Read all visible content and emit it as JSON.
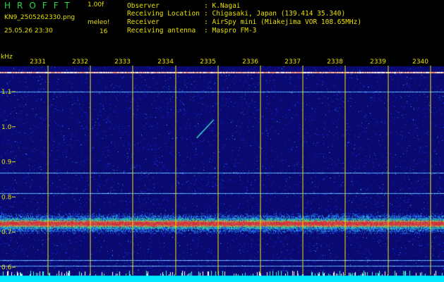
{
  "header": {
    "brand": "HROFFT",
    "version": "1.00f",
    "filename": "KN9_2505262330.png",
    "meteor_label": "meleo!",
    "timestamp": "25.05.26 23:30",
    "meteor_count": "16",
    "meta": [
      {
        "key": "Observer",
        "sep": ":",
        "value": "K.Nagai"
      },
      {
        "key": "Receiving Location",
        "sep": ":",
        "value": "Chigasaki, Japan (139.414 35.340)"
      },
      {
        "key": "Receiver",
        "sep": ":",
        "value": "AirSpy mini (Miakejima VOR 108.65MHz)"
      },
      {
        "key": "Receiving antenna",
        "sep": ":",
        "value": "Maspro FM-3"
      }
    ]
  },
  "colors": {
    "background": "#000000",
    "text": "#e8e000",
    "brand": "#2bd64a",
    "grid_vertical": "#e8e000",
    "carrier_band": "#ff3a3a",
    "bottom_band": "#00ffff",
    "noise_floor": "#0a0a7a"
  },
  "chart_data": {
    "type": "heatmap",
    "ylabel": "kHz",
    "y_ticks": [
      "1.1",
      "1.0",
      "0.9",
      "0.8",
      "0.7",
      "0.6"
    ],
    "y_tick_values": [
      1.1,
      1.0,
      0.9,
      0.8,
      0.7,
      0.6
    ],
    "x_ticks": [
      "2331",
      "2332",
      "2333",
      "2334",
      "2335",
      "2336",
      "2337",
      "2338",
      "2339",
      "2340"
    ],
    "ylim": [
      0.58,
      1.17
    ],
    "horizontal_lines_khz": [
      1.156,
      1.1,
      0.87,
      0.81,
      0.62,
      0.605
    ],
    "carrier_khz": 0.725,
    "meteor_echo": {
      "time_start": "2334.5",
      "time_end": "2334.9",
      "khz_start": 0.98,
      "khz_end": 1.02
    }
  }
}
